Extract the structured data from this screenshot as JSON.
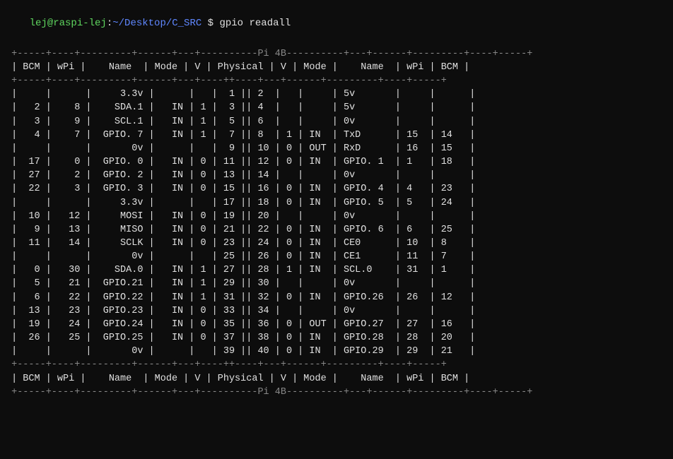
{
  "terminal": {
    "prompt": {
      "user_host": "lej@raspi-lej",
      "path": "~/Desktop/C_SRC",
      "dollar": " $",
      "command": " gpio readall"
    },
    "pi_label": "Pi 4B",
    "header_cols": [
      "BCM",
      "wPi",
      "Name",
      "Mode",
      "V",
      "Physical",
      "V",
      "Mode",
      "Name",
      "wPi",
      "BCM"
    ],
    "rows": [
      {
        "left_bcm": "",
        "left_wpi": "",
        "left_name": "3.3v",
        "left_mode": "",
        "left_v": "",
        "phys_l": "1",
        "phys_r": "2",
        "right_v": "",
        "right_mode": "",
        "right_name": "5v",
        "right_wpi": "",
        "right_bcm": ""
      },
      {
        "left_bcm": "2",
        "left_wpi": "8",
        "left_name": "SDA.1",
        "left_mode": "IN",
        "left_v": "1",
        "phys_l": "3",
        "phys_r": "4",
        "right_v": "",
        "right_mode": "",
        "right_name": "5v",
        "right_wpi": "",
        "right_bcm": ""
      },
      {
        "left_bcm": "3",
        "left_wpi": "9",
        "left_name": "SCL.1",
        "left_mode": "IN",
        "left_v": "1",
        "phys_l": "5",
        "phys_r": "6",
        "right_v": "",
        "right_mode": "",
        "right_name": "0v",
        "right_wpi": "",
        "right_bcm": ""
      },
      {
        "left_bcm": "4",
        "left_wpi": "7",
        "left_name": "GPIO. 7",
        "left_mode": "IN",
        "left_v": "1",
        "phys_l": "7",
        "phys_r": "8",
        "right_v": "1",
        "right_mode": "IN",
        "right_name": "TxD",
        "right_wpi": "15",
        "right_bcm": "14"
      },
      {
        "left_bcm": "",
        "left_wpi": "",
        "left_name": "0v",
        "left_mode": "",
        "left_v": "",
        "phys_l": "9",
        "phys_r": "10",
        "right_v": "0",
        "right_mode": "OUT",
        "right_name": "RxD",
        "right_wpi": "16",
        "right_bcm": "15"
      },
      {
        "left_bcm": "17",
        "left_wpi": "0",
        "left_name": "GPIO. 0",
        "left_mode": "IN",
        "left_v": "0",
        "phys_l": "11",
        "phys_r": "12",
        "right_v": "0",
        "right_mode": "IN",
        "right_name": "GPIO. 1",
        "right_wpi": "1",
        "right_bcm": "18"
      },
      {
        "left_bcm": "27",
        "left_wpi": "2",
        "left_name": "GPIO. 2",
        "left_mode": "IN",
        "left_v": "0",
        "phys_l": "13",
        "phys_r": "14",
        "right_v": "",
        "right_mode": "",
        "right_name": "0v",
        "right_wpi": "",
        "right_bcm": ""
      },
      {
        "left_bcm": "22",
        "left_wpi": "3",
        "left_name": "GPIO. 3",
        "left_mode": "IN",
        "left_v": "0",
        "phys_l": "15",
        "phys_r": "16",
        "right_v": "0",
        "right_mode": "IN",
        "right_name": "GPIO. 4",
        "right_wpi": "4",
        "right_bcm": "23"
      },
      {
        "left_bcm": "",
        "left_wpi": "",
        "left_name": "3.3v",
        "left_mode": "",
        "left_v": "",
        "phys_l": "17",
        "phys_r": "18",
        "right_v": "0",
        "right_mode": "IN",
        "right_name": "GPIO. 5",
        "right_wpi": "5",
        "right_bcm": "24"
      },
      {
        "left_bcm": "10",
        "left_wpi": "12",
        "left_name": "MOSI",
        "left_mode": "IN",
        "left_v": "0",
        "phys_l": "19",
        "phys_r": "20",
        "right_v": "",
        "right_mode": "",
        "right_name": "0v",
        "right_wpi": "",
        "right_bcm": ""
      },
      {
        "left_bcm": "9",
        "left_wpi": "13",
        "left_name": "MISO",
        "left_mode": "IN",
        "left_v": "0",
        "phys_l": "21",
        "phys_r": "22",
        "right_v": "0",
        "right_mode": "IN",
        "right_name": "GPIO. 6",
        "right_wpi": "6",
        "right_bcm": "25"
      },
      {
        "left_bcm": "11",
        "left_wpi": "14",
        "left_name": "SCLK",
        "left_mode": "IN",
        "left_v": "0",
        "phys_l": "23",
        "phys_r": "24",
        "right_v": "0",
        "right_mode": "IN",
        "right_name": "CE0",
        "right_wpi": "10",
        "right_bcm": "8"
      },
      {
        "left_bcm": "",
        "left_wpi": "",
        "left_name": "0v",
        "left_mode": "",
        "left_v": "",
        "phys_l": "25",
        "phys_r": "26",
        "right_v": "0",
        "right_mode": "IN",
        "right_name": "CE1",
        "right_wpi": "11",
        "right_bcm": "7"
      },
      {
        "left_bcm": "0",
        "left_wpi": "30",
        "left_name": "SDA.0",
        "left_mode": "IN",
        "left_v": "1",
        "phys_l": "27",
        "phys_r": "28",
        "right_v": "1",
        "right_mode": "IN",
        "right_name": "SCL.0",
        "right_wpi": "31",
        "right_bcm": "1"
      },
      {
        "left_bcm": "5",
        "left_wpi": "21",
        "left_name": "GPIO.21",
        "left_mode": "IN",
        "left_v": "1",
        "phys_l": "29",
        "phys_r": "30",
        "right_v": "",
        "right_mode": "",
        "right_name": "0v",
        "right_wpi": "",
        "right_bcm": ""
      },
      {
        "left_bcm": "6",
        "left_wpi": "22",
        "left_name": "GPIO.22",
        "left_mode": "IN",
        "left_v": "1",
        "phys_l": "31",
        "phys_r": "32",
        "right_v": "0",
        "right_mode": "IN",
        "right_name": "GPIO.26",
        "right_wpi": "26",
        "right_bcm": "12"
      },
      {
        "left_bcm": "13",
        "left_wpi": "23",
        "left_name": "GPIO.23",
        "left_mode": "IN",
        "left_v": "0",
        "phys_l": "33",
        "phys_r": "34",
        "right_v": "",
        "right_mode": "",
        "right_name": "0v",
        "right_wpi": "",
        "right_bcm": ""
      },
      {
        "left_bcm": "19",
        "left_wpi": "24",
        "left_name": "GPIO.24",
        "left_mode": "IN",
        "left_v": "0",
        "phys_l": "35",
        "phys_r": "36",
        "right_v": "0",
        "right_mode": "OUT",
        "right_name": "GPIO.27",
        "right_wpi": "27",
        "right_bcm": "16"
      },
      {
        "left_bcm": "26",
        "left_wpi": "25",
        "left_name": "GPIO.25",
        "left_mode": "IN",
        "left_v": "0",
        "phys_l": "37",
        "phys_r": "38",
        "right_v": "0",
        "right_mode": "IN",
        "right_name": "GPIO.28",
        "right_wpi": "28",
        "right_bcm": "20"
      },
      {
        "left_bcm": "",
        "left_wpi": "",
        "left_name": "0v",
        "left_mode": "",
        "left_v": "",
        "phys_l": "39",
        "phys_r": "40",
        "right_v": "0",
        "right_mode": "IN",
        "right_name": "GPIO.29",
        "right_wpi": "29",
        "right_bcm": "21"
      }
    ]
  }
}
